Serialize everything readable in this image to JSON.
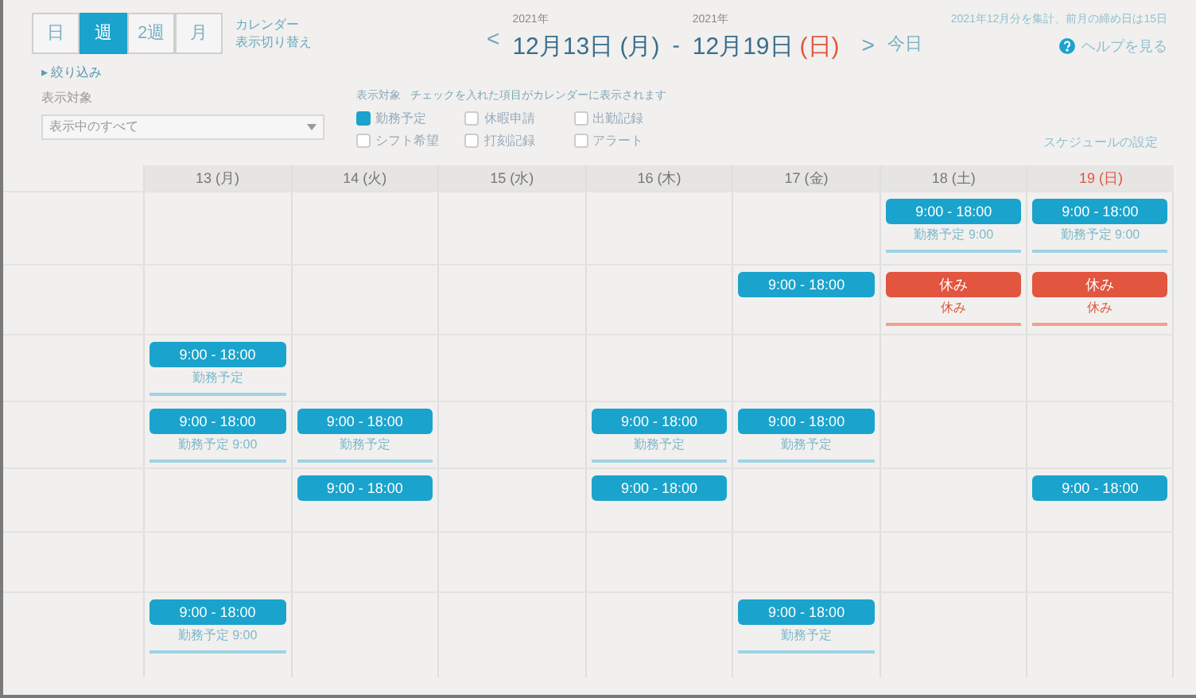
{
  "view_tabs": [
    {
      "label": "日",
      "selected": false
    },
    {
      "label": "週",
      "selected": true
    },
    {
      "label": "2週",
      "selected": false
    },
    {
      "label": "月",
      "selected": false
    }
  ],
  "view_caption": [
    "カレンダー",
    "表示切り替え"
  ],
  "range": {
    "prev": "<",
    "start_year": "2021年",
    "start": "12月13日 (月)",
    "separator": "-",
    "end_year": "2021年",
    "end": "12月19日",
    "end_weekday": "(日)",
    "next": ">",
    "today": "今日"
  },
  "top_right": {
    "note": "2021年12月分を集計、前月の締め日は15日",
    "help": "ヘルプを見る"
  },
  "filter": {
    "toggle_mark": "▸",
    "toggle": "絞り込み",
    "label": "表示対象",
    "select_value": "表示中のすべて",
    "options_title": "表示対象",
    "options_hint": "チェックを入れた項目がカレンダーに表示されます",
    "options": [
      {
        "label": "勤務予定",
        "checked": true
      },
      {
        "label": "休暇申請",
        "checked": false
      },
      {
        "label": "出勤記録",
        "checked": false
      },
      {
        "label": "シフト希望",
        "checked": false
      },
      {
        "label": "打刻記録",
        "checked": false
      },
      {
        "label": "アラート",
        "checked": false
      }
    ],
    "settings_link": "スケジュールの設定"
  },
  "days": [
    {
      "label": "13 (月)",
      "holiday": false
    },
    {
      "label": "14 (火)",
      "holiday": false
    },
    {
      "label": "15 (水)",
      "holiday": false
    },
    {
      "label": "16 (木)",
      "holiday": false
    },
    {
      "label": "17 (金)",
      "holiday": false
    },
    {
      "label": "18 (土)",
      "holiday": false
    },
    {
      "label": "19 (日)",
      "holiday": true
    }
  ],
  "rows": [
    {
      "cells": [
        {},
        {},
        {},
        {},
        {},
        {
          "kind": "work",
          "title": "9:00 - 18:00",
          "note": "勤務予定 9:00"
        },
        {
          "kind": "work",
          "title": "9:00 - 18:00",
          "note": "勤務予定 9:00"
        }
      ]
    },
    {
      "cells": [
        {},
        {},
        {},
        {},
        {
          "kind": "work",
          "title": "9:00 - 18:00"
        },
        {
          "kind": "off",
          "title": "休み",
          "note": "休み"
        },
        {
          "kind": "off",
          "title": "休み",
          "note": "休み"
        }
      ]
    },
    {
      "cells": [
        {
          "kind": "work",
          "title": "9:00 - 18:00",
          "note": "勤務予定"
        },
        {},
        {},
        {},
        {},
        {},
        {}
      ]
    },
    {
      "cells": [
        {
          "kind": "work",
          "title": "9:00 - 18:00",
          "note": "勤務予定 9:00"
        },
        {
          "kind": "work",
          "title": "9:00 - 18:00",
          "note": "勤務予定"
        },
        {},
        {
          "kind": "work",
          "title": "9:00 - 18:00",
          "note": "勤務予定"
        },
        {
          "kind": "work",
          "title": "9:00 - 18:00",
          "note": "勤務予定"
        },
        {},
        {}
      ]
    },
    {
      "cells": [
        {},
        {
          "kind": "work",
          "title": "9:00 - 18:00"
        },
        {},
        {
          "kind": "work",
          "title": "9:00 - 18:00"
        },
        {},
        {},
        {
          "kind": "work",
          "title": "9:00 - 18:00"
        }
      ]
    },
    {
      "cells": [
        {},
        {},
        {},
        {},
        {},
        {},
        {}
      ]
    },
    {
      "cells": [
        {
          "kind": "work",
          "title": "9:00 - 18:00",
          "note": "勤務予定 9:00"
        },
        {},
        {},
        {},
        {
          "kind": "work",
          "title": "9:00 - 18:00",
          "note": "勤務予定"
        },
        {},
        {}
      ]
    }
  ]
}
